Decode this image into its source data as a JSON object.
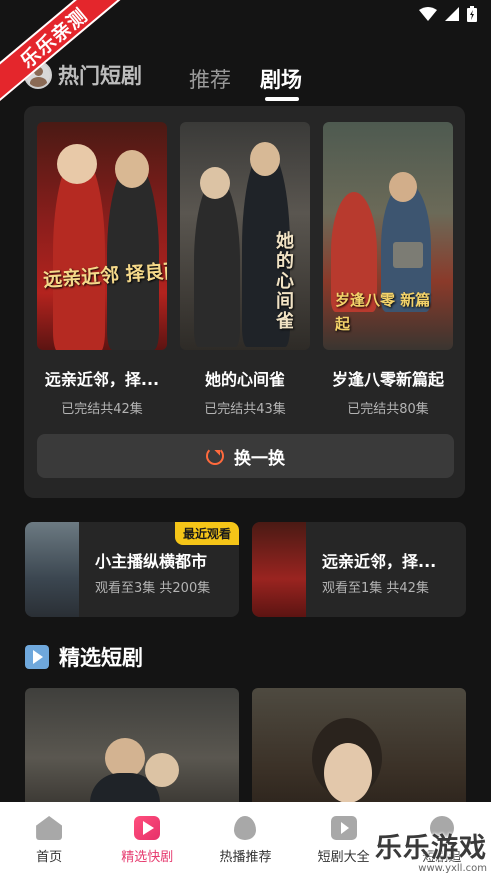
{
  "brand_ribbon": "乐乐亲测",
  "nav": {
    "hot_label": "热门短剧",
    "tabs": [
      {
        "label": "推荐",
        "active": false
      },
      {
        "label": "剧场",
        "active": true
      }
    ]
  },
  "featured": [
    {
      "title": "远亲近邻，择...",
      "meta": "已完结共42集",
      "poster_text": "远亲近邻 择良而交"
    },
    {
      "title": "她的心间雀",
      "meta": "已完结共43集",
      "poster_text": "她的心间雀"
    },
    {
      "title": "岁逢八零新篇起",
      "meta": "已完结共80集",
      "poster_text": "岁逢八零 新篇起"
    }
  ],
  "refresh_label": "换一换",
  "history": [
    {
      "title": "小主播纵横都市",
      "meta": "观看至3集 共200集",
      "badge": "最近观看"
    },
    {
      "title": "远亲近邻，择...",
      "meta": "观看至1集 共42集"
    }
  ],
  "section": {
    "title": "精选短剧"
  },
  "bottom_tabs": [
    {
      "label": "首页",
      "icon": "home-icon",
      "active": false
    },
    {
      "label": "精选快剧",
      "icon": "play-icon",
      "active": true
    },
    {
      "label": "热播推荐",
      "icon": "fire-icon",
      "active": false
    },
    {
      "label": "短剧大全",
      "icon": "tv-icon",
      "active": false
    },
    {
      "label": "短剧追",
      "icon": "user-icon",
      "active": false
    }
  ],
  "watermark": {
    "main": "乐乐游戏",
    "url": "www.yxll.com"
  },
  "colors": {
    "accent": "#e63a6e",
    "badge": "#f5c518",
    "ribbon": "#e4262c",
    "refresh": "#ff6a3d"
  }
}
